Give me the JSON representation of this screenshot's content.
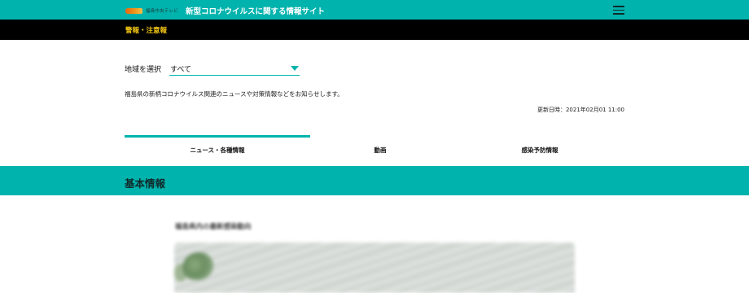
{
  "header": {
    "logo_text": "福島中央テレビ",
    "site_title": "新型コロナウイルスに関する情報サイト",
    "menu_icon": "hamburger-menu-icon",
    "brand_color": "#00b3ad"
  },
  "alert_bar": {
    "link_label": "警報・注意報",
    "label_color": "#f3c614"
  },
  "region": {
    "label": "地域を選択",
    "selected": "すべて"
  },
  "intro_text": "福島県の新柄コロナウイルス関連のニュースや対策情報などをお知らせします。",
  "updated": "更新日時：2021年02月01 11:00",
  "tabs": [
    {
      "label": "ニュース・各種情報",
      "active": true
    },
    {
      "label": "動画",
      "active": false
    },
    {
      "label": "感染予防情報",
      "active": false
    }
  ],
  "section": {
    "title": "基本情報"
  },
  "card": {
    "title": "福島県内の最新感染動向"
  }
}
